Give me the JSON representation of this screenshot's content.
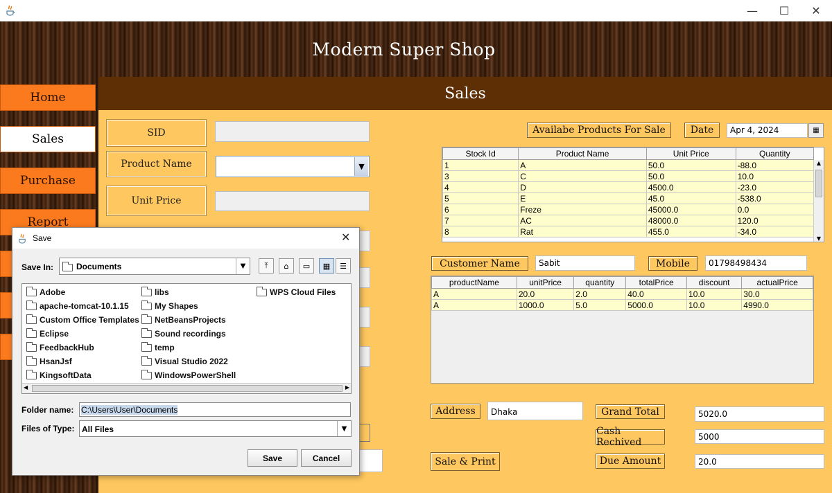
{
  "window": {
    "minimize": "—",
    "maximize": "☐",
    "close": "✕"
  },
  "app_title": "Modern Super Shop",
  "nav": [
    "Home",
    "Sales",
    "Purchase",
    "Report"
  ],
  "section_title": "Sales",
  "form": {
    "sid_label": "SID",
    "product_name_label": "Product Name",
    "unit_price_label": "Unit Price"
  },
  "products": {
    "button": "Availabe Products For Sale",
    "date_label": "Date",
    "date_value": "Apr 4, 2024",
    "columns": [
      "Stock Id",
      "Product Name",
      "Unit Price",
      "Quantity"
    ],
    "rows": [
      [
        "1",
        "A",
        "50.0",
        "-88.0"
      ],
      [
        "3",
        "C",
        "50.0",
        "10.0"
      ],
      [
        "4",
        "D",
        "4500.0",
        "-23.0"
      ],
      [
        "5",
        "E",
        "45.0",
        "-538.0"
      ],
      [
        "6",
        "Freze",
        "45000.0",
        "0.0"
      ],
      [
        "7",
        "AC",
        "48000.0",
        "120.0"
      ],
      [
        "8",
        "Rat",
        "455.0",
        "-34.0"
      ]
    ]
  },
  "customer": {
    "name_label": "Customer Name",
    "name_value": "Sabit",
    "mobile_label": "Mobile",
    "mobile_value": "01798498434"
  },
  "cart": {
    "columns": [
      "productName",
      "unitPrice",
      "quantity",
      "totalPrice",
      "discount",
      "actualPrice"
    ],
    "rows": [
      [
        "A",
        "20.0",
        "2.0",
        "40.0",
        "10.0",
        "30.0"
      ],
      [
        "A",
        "1000.0",
        "5.0",
        "5000.0",
        "10.0",
        "4990.0"
      ]
    ]
  },
  "address": {
    "label": "Address",
    "value": "Dhaka"
  },
  "totals": {
    "grand_label": "Grand Total",
    "grand_value": "5020.0",
    "cash_label": "Cash Rechived",
    "cash_value": "5000",
    "due_label": "Due Amount",
    "due_value": "20.0"
  },
  "sale_print": "Sale & Print",
  "dialog": {
    "title": "Save",
    "save_in_label": "Save In:",
    "save_in_value": "Documents",
    "folders_col1": [
      "Adobe",
      "apache-tomcat-10.1.15",
      "Custom Office Templates",
      "Eclipse",
      "FeedbackHub",
      "HsanJsf",
      "KingsoftData"
    ],
    "folders_col2": [
      "libs",
      "My Shapes",
      "NetBeansProjects",
      "Sound recordings",
      "temp",
      "Visual Studio 2022",
      "WindowsPowerShell"
    ],
    "folders_col3": [
      "WPS Cloud Files"
    ],
    "folder_name_label": "Folder name:",
    "folder_name_value": "C:\\Users\\User\\Documents",
    "files_type_label": "Files of Type:",
    "files_type_value": "All Files",
    "save_button": "Save",
    "cancel_button": "Cancel"
  }
}
